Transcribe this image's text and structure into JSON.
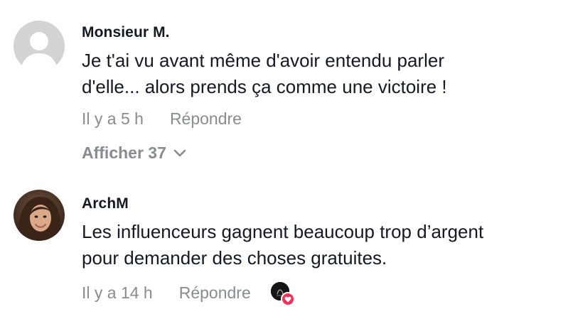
{
  "comments": [
    {
      "username": "Monsieur M.",
      "text": "Je t'ai vu avant même d'avoir entendu parler\nd'elle... alors prends ça comme une victoire !",
      "time": "Il y a 5 h",
      "reply_label": "Répondre",
      "avatar_icon": "default-user-avatar"
    },
    {
      "username": "ArchM",
      "text": "Les influenceurs gagnent beaucoup trop d’argent\npour demander des choses gratuites.",
      "time": "Il y a 14 h",
      "reply_label": "Répondre",
      "avatar_icon": "user-photo-avatar",
      "creator_liked": true
    }
  ],
  "view_replies": {
    "label": "Afficher 37",
    "icon": "chevron-down-icon"
  },
  "colors": {
    "text_primary": "#161823",
    "text_secondary": "#8a8b91",
    "like_red": "#fe2c55"
  }
}
